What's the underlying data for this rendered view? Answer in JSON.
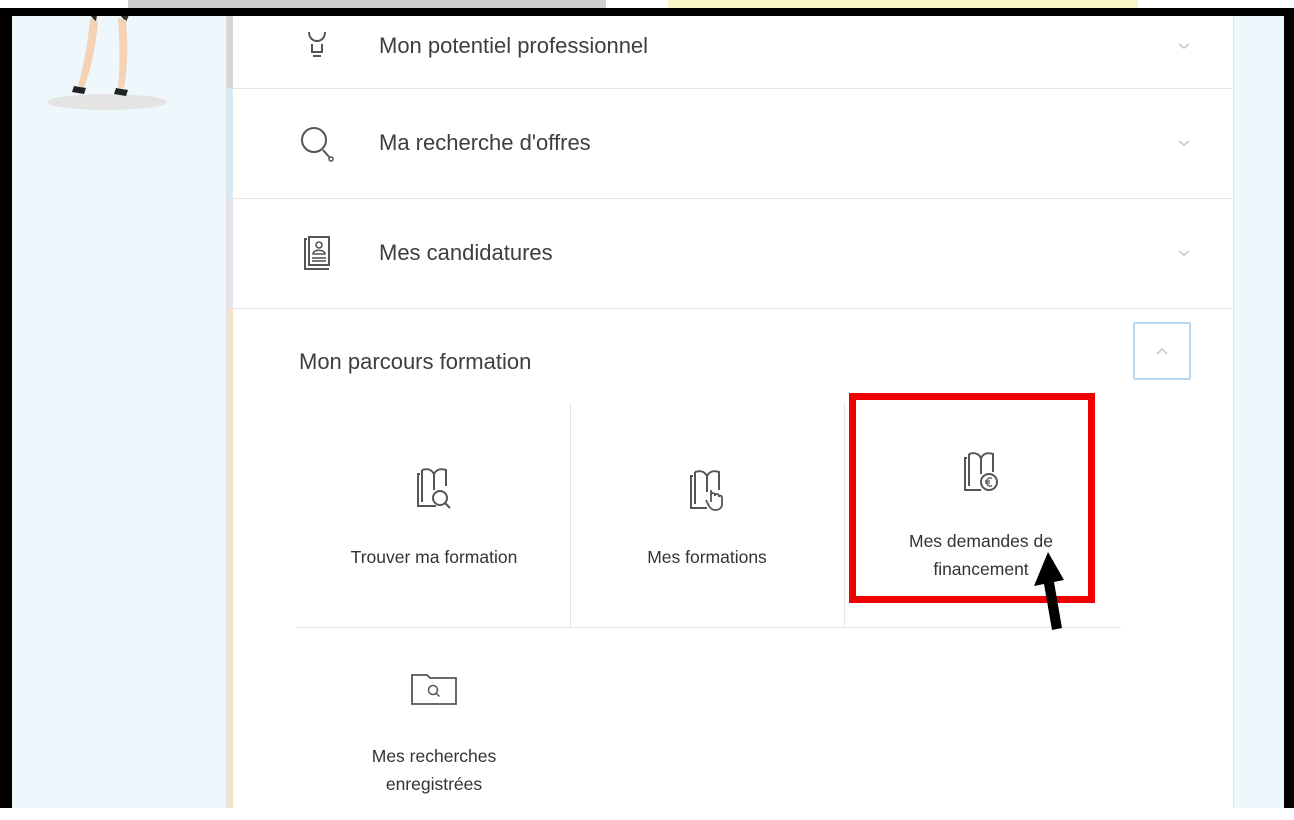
{
  "menu": {
    "rows": [
      {
        "label": "Mon potentiel professionnel",
        "icon": "lightbulb-icon"
      },
      {
        "label": "Ma recherche d'offres",
        "icon": "search-icon"
      },
      {
        "label": "Mes candidatures",
        "icon": "candidate-file-icon"
      }
    ],
    "section": {
      "title": "Mon parcours formation",
      "tiles": [
        {
          "label": "Trouver ma formation",
          "icon": "book-search-icon"
        },
        {
          "label": "Mes formations",
          "icon": "book-hand-icon"
        },
        {
          "label_line1": "Mes demandes de",
          "label_line2": "financement",
          "icon": "book-euro-icon"
        },
        {
          "label_line1": "Mes recherches",
          "label_line2": "enregistrées",
          "icon": "folder-search-icon"
        }
      ]
    }
  },
  "colors": {
    "highlight_border": "#ee0000",
    "frame": "#000000",
    "side_background": "#eef7fb",
    "accent_blue": "#d8ebf5",
    "accent_lilac": "#e4e2ef",
    "accent_peach": "#f5e3cf"
  }
}
